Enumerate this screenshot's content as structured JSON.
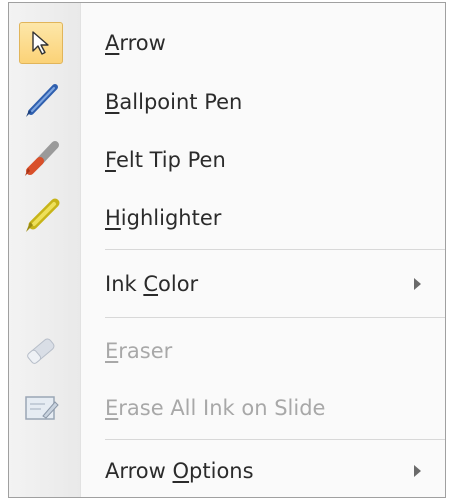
{
  "menu": {
    "items": [
      {
        "label_pre": "",
        "label_key": "A",
        "label_post": "rrow",
        "icon": "arrow-cursor-icon",
        "selected": true,
        "disabled": false,
        "submenu": false
      },
      {
        "label_pre": "",
        "label_key": "B",
        "label_post": "allpoint Pen",
        "icon": "ballpoint-pen-icon",
        "selected": false,
        "disabled": false,
        "submenu": false
      },
      {
        "label_pre": "",
        "label_key": "F",
        "label_post": "elt Tip Pen",
        "icon": "felt-tip-pen-icon",
        "selected": false,
        "disabled": false,
        "submenu": false
      },
      {
        "label_pre": "",
        "label_key": "H",
        "label_post": "ighlighter",
        "icon": "highlighter-icon",
        "selected": false,
        "disabled": false,
        "submenu": false
      },
      {
        "label_pre": "Ink ",
        "label_key": "C",
        "label_post": "olor",
        "icon": "",
        "selected": false,
        "disabled": false,
        "submenu": true
      },
      {
        "label_pre": "",
        "label_key": "E",
        "label_post": "raser",
        "icon": "eraser-icon",
        "selected": false,
        "disabled": true,
        "submenu": false
      },
      {
        "label_pre": "",
        "label_key": "E",
        "label_post": "rase All Ink on Slide",
        "icon": "erase-all-ink-icon",
        "selected": false,
        "disabled": true,
        "submenu": false
      },
      {
        "label_pre": "Arrow ",
        "label_key": "O",
        "label_post": "ptions",
        "icon": "",
        "selected": false,
        "disabled": false,
        "submenu": true
      }
    ]
  },
  "colors": {
    "selection_fill": "#fbd277",
    "selection_border": "#e1b55a",
    "text": "#2b2b2b",
    "disabled_text": "#a8a8a8",
    "ballpoint": "#3a6fc4",
    "felt_tip": "#d9502a",
    "highlighter": "#e6d21e"
  }
}
